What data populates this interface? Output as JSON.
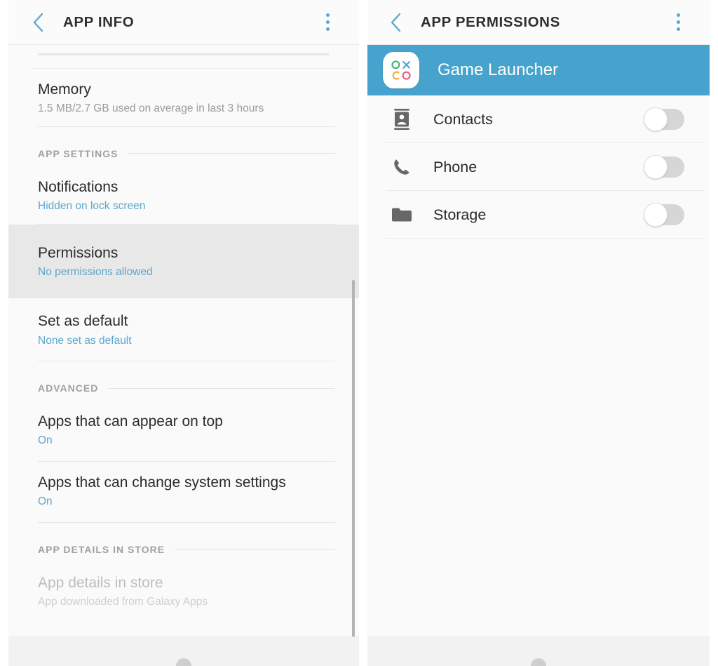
{
  "theme": {
    "accent": "#46a3cd",
    "link": "#5ba7cc",
    "selected_row_bg": "#e8e8e8",
    "page_bg": "#fafafa",
    "title_color": "#2b2b2b",
    "muted": "#9b9b9b"
  },
  "left_panel": {
    "actionbar": {
      "back_icon": "chevron-left-icon",
      "title": "APP INFO",
      "overflow_icon": "more-vertical-icon"
    },
    "rows": [
      {
        "id": "memory",
        "title": "Memory",
        "subtitle": "1.5 MB/2.7 GB used on average in last 3 hours",
        "selected": false,
        "dim": false,
        "divider": true
      },
      {
        "id": "notifications",
        "title": "Notifications",
        "subtitle": "Hidden on lock screen",
        "selected": false,
        "dim": false,
        "divider": true
      },
      {
        "id": "permissions",
        "title": "Permissions",
        "subtitle": "No permissions allowed",
        "selected": true,
        "dim": false,
        "divider": false
      },
      {
        "id": "set-as-default",
        "title": "Set as default",
        "subtitle": "None set as default",
        "selected": false,
        "dim": false,
        "divider": true
      },
      {
        "id": "apps-appear-on-top",
        "title": "Apps that can appear on top",
        "subtitle": "On",
        "selected": false,
        "dim": false,
        "divider": true
      },
      {
        "id": "apps-change-system-settings",
        "title": "Apps that can change system settings",
        "subtitle": "On",
        "selected": false,
        "dim": false,
        "divider": true
      },
      {
        "id": "app-details-in-store",
        "title": "App details in store",
        "subtitle": "App downloaded from Galaxy Apps",
        "selected": false,
        "dim": true,
        "divider": false
      }
    ],
    "sections": {
      "app_settings": "APP SETTINGS",
      "advanced": "ADVANCED",
      "app_details_in_store": "APP DETAILS IN STORE"
    }
  },
  "right_panel": {
    "actionbar": {
      "back_icon": "chevron-left-icon",
      "title": "APP PERMISSIONS",
      "overflow_icon": "more-vertical-icon"
    },
    "app": {
      "name": "Game Launcher",
      "icon": "game-launcher-icon",
      "icon_colors": {
        "circle_top_left": "#4caf7d",
        "x_top_right": "#4aa8e0",
        "c_bottom_left": "#f2a93b",
        "circle_bottom_right": "#ef5a7e"
      }
    },
    "permissions": [
      {
        "id": "contacts",
        "label": "Contacts",
        "icon": "contacts-icon",
        "enabled": false
      },
      {
        "id": "phone",
        "label": "Phone",
        "icon": "phone-icon",
        "enabled": false
      },
      {
        "id": "storage",
        "label": "Storage",
        "icon": "folder-icon",
        "enabled": false
      }
    ]
  },
  "navbar": {
    "home_icon": "home-indicator-icon"
  }
}
